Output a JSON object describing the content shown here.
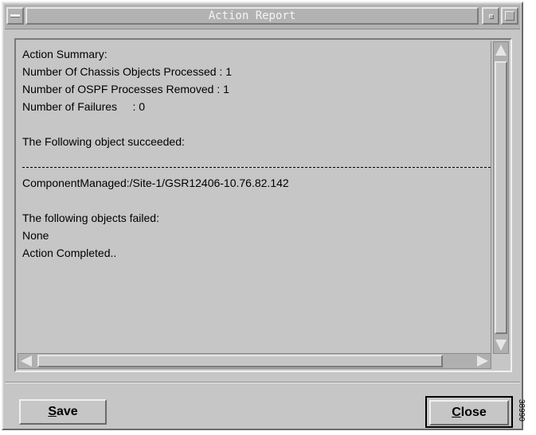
{
  "window": {
    "title": "Action Report"
  },
  "report": {
    "lines": [
      "Action Summary:",
      "Number Of Chassis Objects Processed : 1",
      "Number of OSPF Processes Removed : 1",
      "Number of Failures     : 0",
      "",
      "The Following object succeeded:",
      "ComponentManaged:/Site-1/GSR12406-10.76.82.142",
      "",
      "The following objects failed:",
      "None",
      "Action Completed.."
    ]
  },
  "buttons": {
    "save": {
      "accel": "S",
      "rest": "ave"
    },
    "close": {
      "accel": "C",
      "rest": "lose"
    }
  },
  "figure_code": "38990"
}
